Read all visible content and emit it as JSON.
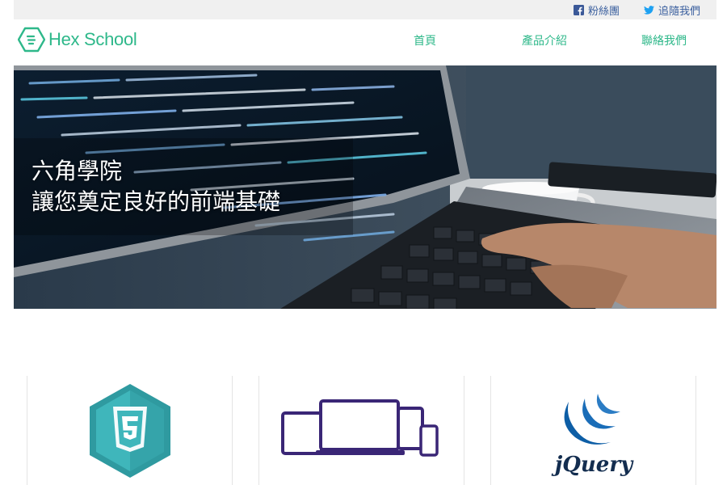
{
  "topbar": {
    "facebook": {
      "label": "粉絲團",
      "icon": "facebook-icon",
      "color": "#3b5998"
    },
    "twitter": {
      "label": "追隨我們",
      "icon": "twitter-icon",
      "color": "#1da1f2"
    }
  },
  "header": {
    "logo_text": "Hex School",
    "nav": [
      {
        "label": "首頁"
      },
      {
        "label": "產品介紹"
      },
      {
        "label": "聯絡我們"
      }
    ],
    "accent_color": "#2eb88a"
  },
  "hero": {
    "line1": "六角學院",
    "line2": "讓您奠定良好的前端基礎"
  },
  "features": [
    {
      "icon": "html5-icon"
    },
    {
      "icon": "responsive-devices-icon"
    },
    {
      "icon": "jquery-logo-icon",
      "label": "jQuery"
    }
  ]
}
